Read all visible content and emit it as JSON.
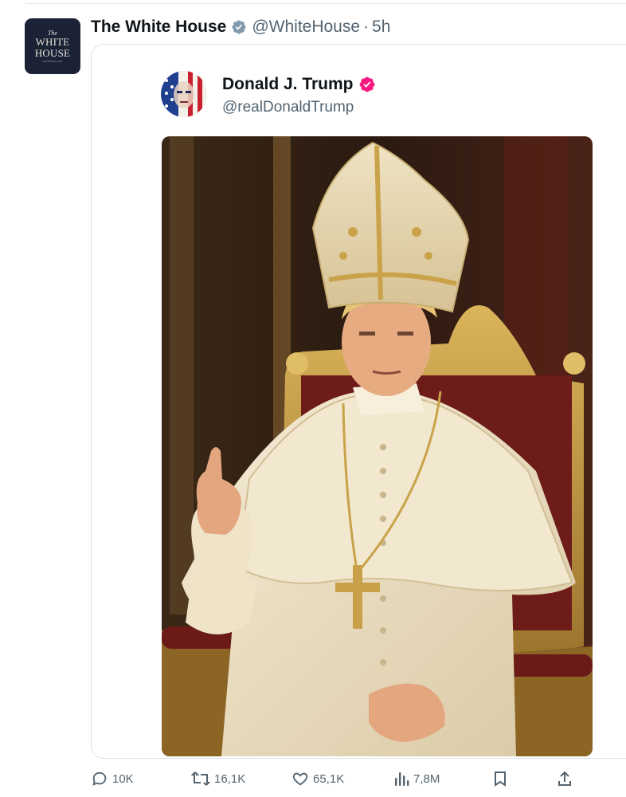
{
  "post": {
    "author_avatar": {
      "line1": "The",
      "line2": "WHITE",
      "line3": "HOUSE",
      "line4": "WASHINGTON"
    },
    "author_name": "The White House",
    "handle": "@WhiteHouse",
    "separator": "·",
    "timestamp": "5h",
    "verified_color": "#829aab"
  },
  "quoted_post": {
    "author_name": "Donald J. Trump",
    "handle": "@realDonaldTrump",
    "verified_color": "#f91880",
    "media": {
      "kind": "image",
      "subject": "pope-portrait"
    }
  },
  "actions": {
    "replies": "10K",
    "reposts": "16,1K",
    "likes": "65,1K",
    "views": "7,8M",
    "icons": [
      "reply-icon",
      "repost-icon",
      "like-icon",
      "views-icon",
      "bookmark-icon",
      "share-icon"
    ]
  }
}
